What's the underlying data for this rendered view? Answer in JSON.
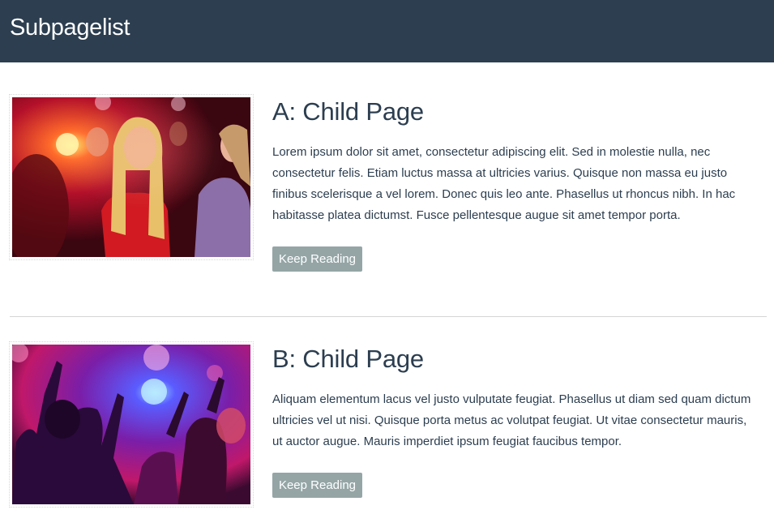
{
  "header": {
    "title": "Subpagelist"
  },
  "entries": [
    {
      "title": "A: Child Page",
      "body": "Lorem ipsum dolor sit amet, consectetur adipiscing elit. Sed in molestie nulla, nec consectetur felis. Etiam luctus massa at ultricies varius. Quisque non massa eu justo finibus scelerisque a vel lorem. Donec quis leo ante. Phasellus ut rhoncus nibh. In hac habitasse platea dictumst. Fusce pellentesque augue sit amet tempor porta.",
      "button_label": "Keep Reading",
      "image": "party-photo"
    },
    {
      "title": "B: Child Page",
      "body": "Aliquam elementum lacus vel justo vulputate feugiat. Phasellus ut diam sed quam dictum ultricies vel ut nisi. Quisque porta metus ac volutpat feugiat. Ut vitae consectetur mauris, ut auctor augue. Mauris imperdiet ipsum feugiat faucibus tempor.",
      "button_label": "Keep Reading",
      "image": "concert-crowd-photo"
    }
  ],
  "colors": {
    "header_bg": "#2c3e50",
    "text": "#2c3e50",
    "button_bg": "#95a5a6",
    "divider": "#d5d5d5"
  }
}
